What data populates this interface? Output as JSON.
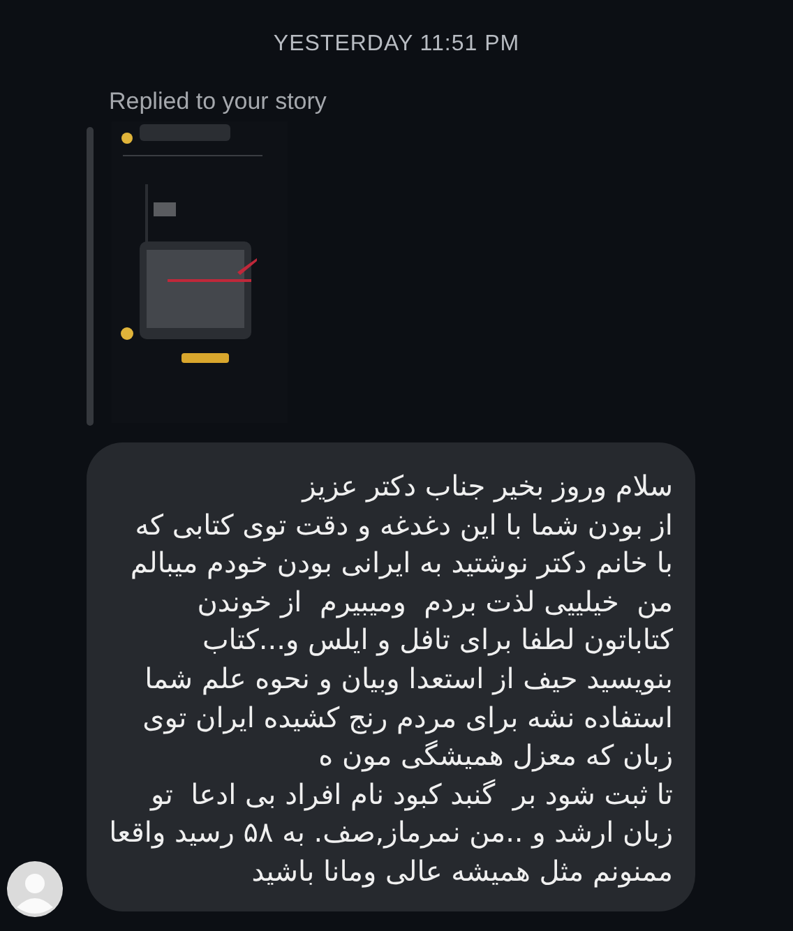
{
  "timestamp": "YESTERDAY 11:51 PM",
  "story_reply": {
    "label": "Replied to your story"
  },
  "message": {
    "text": "سلام وروز بخیر جناب دکتر عزیز\nاز بودن شما با این دغدغه و دقت توی کتابی که\nبا خانم دکتر نوشتید به ایرانی بودن خودم میبالم\nمن  خیلییی لذت بردم  ومیبیرم  از خوندن\nکتاباتون لطفا برای تافل و ایلس و...کتاب\nبنویسید حیف از استعدا وبیان و نحوه علم شما\nاستفاده نشه برای مردم رنج کشیده ایران توی\nزبان که معزل همیشگی مون ه\nتا ثبت شود بر  گنبد کبود نام افراد بی ادعا  تو\nزبان ارشد و ..من نمرماز,صف. به ۵۸ رسید واقعا\nممنونم مثل همیشه عالی ومانا باشید"
  }
}
